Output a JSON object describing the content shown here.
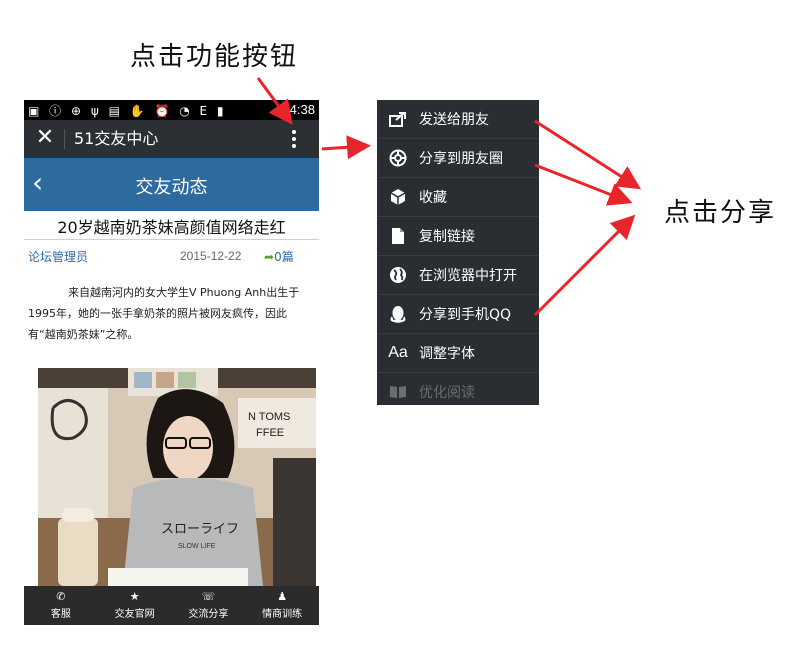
{
  "annotations": {
    "click_menu_button": "点击功能按钮",
    "click_share": "点击分享"
  },
  "status_bar": {
    "time": "14:38"
  },
  "wechat_bar": {
    "close_icon": "close-icon",
    "title": "51交友中心",
    "more_icon": "more-vertical-icon"
  },
  "site_header": {
    "back_icon": "chevron-left-icon",
    "title": "交友动态"
  },
  "article": {
    "title": "20岁越南奶茶妹高颜值网络走红",
    "author": "论坛管理员",
    "date": "2015-12-22",
    "share_count": "0篇",
    "body": "来自越南河内的女大学生V Phuong Anh出生于1995年，她的一张手拿奶茶的照片被网友疯传，因此有“越南奶茶妹”之称。",
    "photo_text_shirt_main": "スローライフ",
    "photo_text_shirt_sub": "SLOW LIFE",
    "photo_text_sign": "N TOMS",
    "photo_text_sign2": "FFEE"
  },
  "tab_bar": {
    "items": [
      {
        "label": "客服",
        "icon": "phone-icon"
      },
      {
        "label": "交友官网",
        "icon": "star-icon"
      },
      {
        "label": "交流分享",
        "icon": "chat-icon"
      },
      {
        "label": "情商训练",
        "icon": "person-icon"
      }
    ]
  },
  "menu": {
    "items": [
      {
        "label": "发送给朋友",
        "icon": "send-to-friend-icon"
      },
      {
        "label": "分享到朋友圈",
        "icon": "moments-icon"
      },
      {
        "label": "收藏",
        "icon": "favorite-cube-icon"
      },
      {
        "label": "复制链接",
        "icon": "copy-link-icon"
      },
      {
        "label": "在浏览器中打开",
        "icon": "browser-globe-icon"
      },
      {
        "label": "分享到手机QQ",
        "icon": "qq-icon"
      },
      {
        "label": "调整字体",
        "icon": "font-size-icon"
      },
      {
        "label": "优化阅读",
        "icon": "reading-book-icon"
      }
    ]
  },
  "colors": {
    "site_header": "#2d6a9e",
    "wechat_bar": "#2c2f33",
    "menu_bg": "#2a2d31",
    "arrow_red": "#e8252b",
    "link_blue": "#2d6aa8"
  }
}
